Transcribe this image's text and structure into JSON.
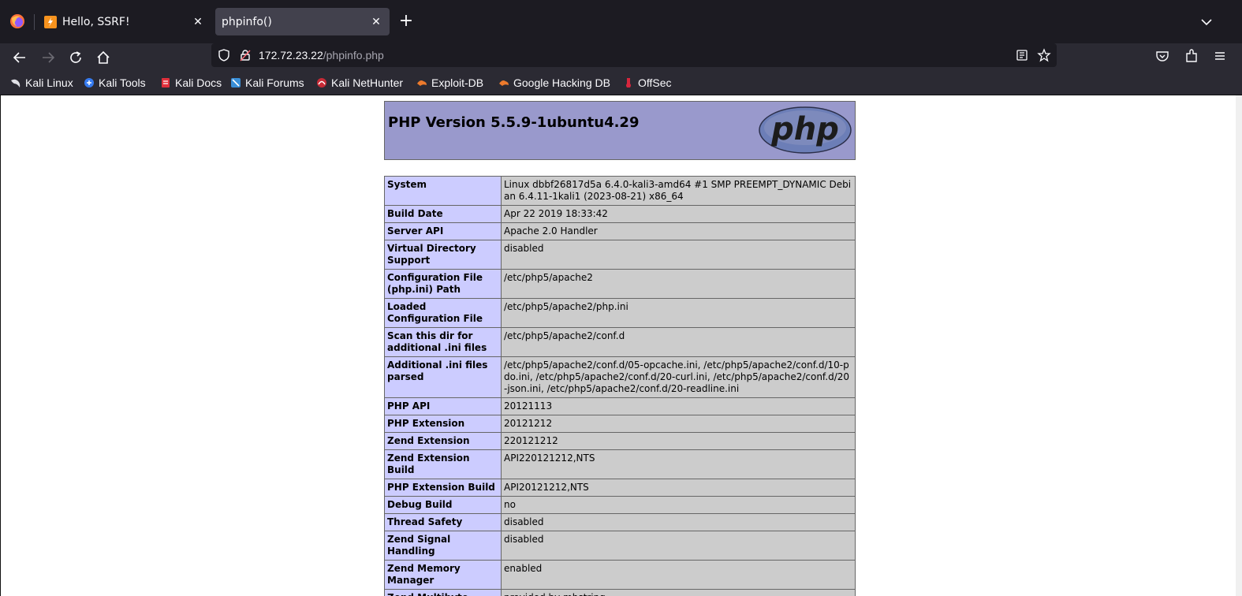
{
  "browser": {
    "tabs": [
      {
        "title": "Hello, SSRF!",
        "active": false
      },
      {
        "title": "phpinfo()",
        "active": true
      }
    ],
    "url": {
      "host": "172.72.23.22",
      "path": "/phpinfo.php"
    },
    "bookmarks": [
      {
        "label": "Kali Linux",
        "icon": "kali-dragon-icon"
      },
      {
        "label": "Kali Tools",
        "icon": "kali-tools-icon"
      },
      {
        "label": "Kali Docs",
        "icon": "kali-docs-icon"
      },
      {
        "label": "Kali Forums",
        "icon": "kali-forums-icon"
      },
      {
        "label": "Kali NetHunter",
        "icon": "kali-nethunter-icon"
      },
      {
        "label": "Exploit-DB",
        "icon": "exploit-db-icon"
      },
      {
        "label": "Google Hacking DB",
        "icon": "ghdb-icon"
      },
      {
        "label": "OffSec",
        "icon": "offsec-icon"
      }
    ]
  },
  "phpinfo": {
    "version_title": "PHP Version 5.5.9-1ubuntu4.29",
    "logo_text": "php",
    "rows": [
      {
        "key": "System",
        "value": "Linux dbbf26817d5a 6.4.0-kali3-amd64 #1 SMP PREEMPT_DYNAMIC Debian 6.4.11-1kali1 (2023-08-21) x86_64"
      },
      {
        "key": "Build Date",
        "value": "Apr 22 2019 18:33:42"
      },
      {
        "key": "Server API",
        "value": "Apache 2.0 Handler"
      },
      {
        "key": "Virtual Directory Support",
        "value": "disabled"
      },
      {
        "key": "Configuration File (php.ini) Path",
        "value": "/etc/php5/apache2"
      },
      {
        "key": "Loaded Configuration File",
        "value": "/etc/php5/apache2/php.ini"
      },
      {
        "key": "Scan this dir for additional .ini files",
        "value": "/etc/php5/apache2/conf.d"
      },
      {
        "key": "Additional .ini files parsed",
        "value": "/etc/php5/apache2/conf.d/05-opcache.ini, /etc/php5/apache2/conf.d/10-pdo.ini, /etc/php5/apache2/conf.d/20-curl.ini, /etc/php5/apache2/conf.d/20-json.ini, /etc/php5/apache2/conf.d/20-readline.ini"
      },
      {
        "key": "PHP API",
        "value": "20121113"
      },
      {
        "key": "PHP Extension",
        "value": "20121212"
      },
      {
        "key": "Zend Extension",
        "value": "220121212"
      },
      {
        "key": "Zend Extension Build",
        "value": "API220121212,NTS"
      },
      {
        "key": "PHP Extension Build",
        "value": "API20121212,NTS"
      },
      {
        "key": "Debug Build",
        "value": "no"
      },
      {
        "key": "Thread Safety",
        "value": "disabled"
      },
      {
        "key": "Zend Signal Handling",
        "value": "disabled"
      },
      {
        "key": "Zend Memory Manager",
        "value": "enabled"
      },
      {
        "key": "Zend Multibyte Support",
        "value": "provided by mbstring"
      }
    ]
  },
  "colors": {
    "header_bg": "#9999cc",
    "key_bg": "#ccccff",
    "value_bg": "#cccccc",
    "chrome_dark": "#1c1b22",
    "chrome_mid": "#2b2a33"
  }
}
